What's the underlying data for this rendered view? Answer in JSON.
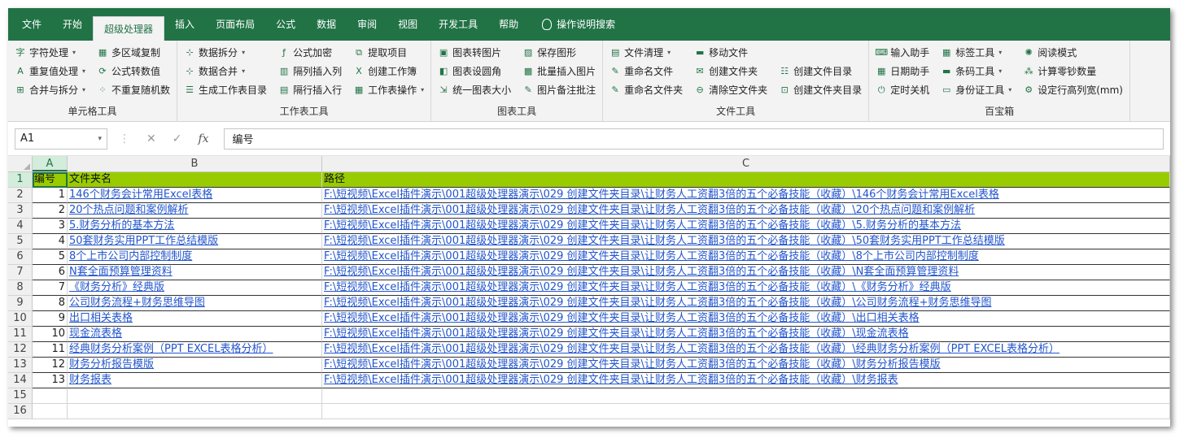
{
  "tabs": [
    "文件",
    "开始",
    "超级处理器",
    "插入",
    "页面布局",
    "公式",
    "数据",
    "审阅",
    "视图",
    "开发工具",
    "帮助"
  ],
  "active_tab_index": 2,
  "search_label": "操作说明搜索",
  "groups": [
    {
      "label": "单元格工具",
      "cols": [
        [
          {
            "icon": "字",
            "label": "字符处理",
            "dd": true
          },
          {
            "icon": "A",
            "label": "重复值处理",
            "dd": true
          },
          {
            "icon": "⊞",
            "label": "合并与拆分",
            "dd": true
          }
        ],
        [
          {
            "icon": "▦",
            "label": "多区域复制",
            "dd": false
          },
          {
            "icon": "⟳",
            "label": "公式转数值",
            "dd": false
          },
          {
            "icon": "⁘",
            "label": "不重复随机数",
            "dd": false
          }
        ]
      ]
    },
    {
      "label": "工作表工具",
      "cols": [
        [
          {
            "icon": "⊹",
            "label": "数据拆分",
            "dd": true
          },
          {
            "icon": "⊹",
            "label": "数据合并",
            "dd": true
          },
          {
            "icon": "☰",
            "label": "生成工作表目录",
            "dd": false
          }
        ],
        [
          {
            "icon": "ƒ",
            "label": "公式加密",
            "dd": false
          },
          {
            "icon": "▥",
            "label": "隔列插入列",
            "dd": false
          },
          {
            "icon": "▤",
            "label": "隔行插入行",
            "dd": false
          }
        ],
        [
          {
            "icon": "⧉",
            "label": "提取项目",
            "dd": false
          },
          {
            "icon": "X",
            "label": "创建工作簿",
            "dd": false
          },
          {
            "icon": "▦",
            "label": "工作表操作",
            "dd": true
          }
        ]
      ]
    },
    {
      "label": "图表工具",
      "cols": [
        [
          {
            "icon": "▣",
            "label": "图表转图片",
            "dd": false
          },
          {
            "icon": "◧",
            "label": "图表设圆角",
            "dd": false
          },
          {
            "icon": "⇲",
            "label": "统一图表大小",
            "dd": false
          }
        ],
        [
          {
            "icon": "▨",
            "label": "保存图形",
            "dd": false
          },
          {
            "icon": "▩",
            "label": "批量插入图片",
            "dd": false
          },
          {
            "icon": "✎",
            "label": "图片备注批注",
            "dd": false
          }
        ]
      ]
    },
    {
      "label": "文件工具",
      "cols": [
        [
          {
            "icon": "▤",
            "label": "文件清理",
            "dd": true
          },
          {
            "icon": "✎",
            "label": "重命名文件",
            "dd": false
          },
          {
            "icon": "✎",
            "label": "重命名文件夹",
            "dd": false
          }
        ],
        [
          {
            "icon": "▬",
            "label": "移动文件",
            "dd": false
          },
          {
            "icon": "✉",
            "label": "创建文件夹",
            "dd": false
          },
          {
            "icon": "⊖",
            "label": "清除空文件夹",
            "dd": false
          }
        ],
        [
          {
            "icon": "",
            "label": "",
            "dd": false
          },
          {
            "icon": "☷",
            "label": "创建文件目录",
            "dd": false
          },
          {
            "icon": "⊡",
            "label": "创建文件夹目录",
            "dd": false
          }
        ]
      ]
    },
    {
      "label": "百宝箱",
      "cols": [
        [
          {
            "icon": "⌨",
            "label": "输入助手",
            "dd": false
          },
          {
            "icon": "▦",
            "label": "日期助手",
            "dd": false
          },
          {
            "icon": "⏻",
            "label": "定时关机",
            "dd": false
          }
        ],
        [
          {
            "icon": "▦",
            "label": "标签工具",
            "dd": true
          },
          {
            "icon": "▬",
            "label": "条码工具",
            "dd": true
          },
          {
            "icon": "▭",
            "label": "身份证工具",
            "dd": true
          }
        ],
        [
          {
            "icon": "✺",
            "label": "阅读模式",
            "dd": false
          },
          {
            "icon": "⁂",
            "label": "计算零钞数量",
            "dd": false
          },
          {
            "icon": "⚙",
            "label": "设定行高列宽(mm)",
            "dd": false
          }
        ]
      ]
    }
  ],
  "formula_bar": {
    "name_box": "A1",
    "value": "编号"
  },
  "columns": [
    "A",
    "B",
    "C"
  ],
  "rows": [
    {
      "n": "1",
      "a": "编号",
      "b": "文件夹名",
      "c": "路径"
    },
    {
      "n": "2",
      "a": "1",
      "b": "146个财务会计常用Excel表格",
      "c": "F:\\短视频\\Excel插件演示\\001超级处理器演示\\029 创建文件夹目录\\让财务人工资翻3倍的五个必备技能（收藏）\\146个财务会计常用Excel表格"
    },
    {
      "n": "3",
      "a": "2",
      "b": "20个热点问题和案例解析",
      "c": "F:\\短视频\\Excel插件演示\\001超级处理器演示\\029 创建文件夹目录\\让财务人工资翻3倍的五个必备技能（收藏）\\20个热点问题和案例解析"
    },
    {
      "n": "4",
      "a": "3",
      "b": "5.财务分析的基本方法",
      "c": "F:\\短视频\\Excel插件演示\\001超级处理器演示\\029 创建文件夹目录\\让财务人工资翻3倍的五个必备技能（收藏）\\5.财务分析的基本方法"
    },
    {
      "n": "5",
      "a": "4",
      "b": "50套财务实用PPT工作总结模版",
      "c": "F:\\短视频\\Excel插件演示\\001超级处理器演示\\029 创建文件夹目录\\让财务人工资翻3倍的五个必备技能（收藏）\\50套财务实用PPT工作总结模版"
    },
    {
      "n": "6",
      "a": "5",
      "b": "8个上市公司内部控制制度",
      "c": "F:\\短视频\\Excel插件演示\\001超级处理器演示\\029 创建文件夹目录\\让财务人工资翻3倍的五个必备技能（收藏）\\8个上市公司内部控制制度"
    },
    {
      "n": "7",
      "a": "6",
      "b": "N套全面预算管理资料",
      "c": "F:\\短视频\\Excel插件演示\\001超级处理器演示\\029 创建文件夹目录\\让财务人工资翻3倍的五个必备技能（收藏）\\N套全面预算管理资料"
    },
    {
      "n": "8",
      "a": "7",
      "b": "《财务分析》经典版",
      "c": "F:\\短视频\\Excel插件演示\\001超级处理器演示\\029 创建文件夹目录\\让财务人工资翻3倍的五个必备技能（收藏）\\《财务分析》经典版"
    },
    {
      "n": "9",
      "a": "8",
      "b": "公司财务流程+财务思维导图",
      "c": "F:\\短视频\\Excel插件演示\\001超级处理器演示\\029 创建文件夹目录\\让财务人工资翻3倍的五个必备技能（收藏）\\公司财务流程+财务思维导图"
    },
    {
      "n": "10",
      "a": "9",
      "b": "出口相关表格",
      "c": "F:\\短视频\\Excel插件演示\\001超级处理器演示\\029 创建文件夹目录\\让财务人工资翻3倍的五个必备技能（收藏）\\出口相关表格"
    },
    {
      "n": "11",
      "a": "10",
      "b": "现金流表格",
      "c": "F:\\短视频\\Excel插件演示\\001超级处理器演示\\029 创建文件夹目录\\让财务人工资翻3倍的五个必备技能（收藏）\\现金流表格"
    },
    {
      "n": "12",
      "a": "11",
      "b": "经典财务分析案例（PPT EXCEL表格分析）",
      "c": "F:\\短视频\\Excel插件演示\\001超级处理器演示\\029 创建文件夹目录\\让财务人工资翻3倍的五个必备技能（收藏）\\经典财务分析案例（PPT EXCEL表格分析）"
    },
    {
      "n": "13",
      "a": "12",
      "b": "财务分析报告模版",
      "c": "F:\\短视频\\Excel插件演示\\001超级处理器演示\\029 创建文件夹目录\\让财务人工资翻3倍的五个必备技能（收藏）\\财务分析报告模版"
    },
    {
      "n": "14",
      "a": "13",
      "b": "财务报表",
      "c": "F:\\短视频\\Excel插件演示\\001超级处理器演示\\029 创建文件夹目录\\让财务人工资翻3倍的五个必备技能（收藏）\\财务报表"
    },
    {
      "n": "15",
      "a": "",
      "b": "",
      "c": ""
    },
    {
      "n": "16",
      "a": "",
      "b": "",
      "c": ""
    }
  ],
  "colors": {
    "ribbon_green": "#217346",
    "header_fill": "#99cc00",
    "link": "#2255cc"
  }
}
